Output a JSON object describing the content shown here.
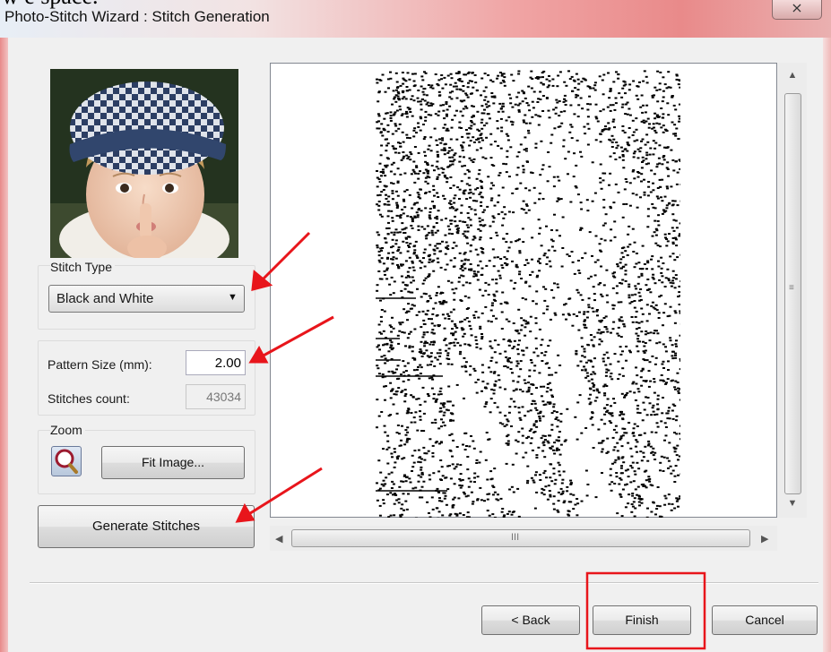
{
  "overlay_text": "w e  space.",
  "window": {
    "title": "Photo-Stitch Wizard : Stitch Generation",
    "close_glyph": "⨯"
  },
  "stitch_type": {
    "group_label": "Stitch Type",
    "selected": "Black and White"
  },
  "pattern": {
    "size_label": "Pattern Size (mm):",
    "size_value": "2.00",
    "count_label": "Stitches count:",
    "count_value": "43034"
  },
  "zoom": {
    "group_label": "Zoom",
    "fit_label": "Fit Image..."
  },
  "generate_label": "Generate Stitches",
  "footer": {
    "back_label": "< Back",
    "finish_label": "Finish",
    "cancel_label": "Cancel"
  },
  "scroll_grip": "III",
  "colors": {
    "annotation_red": "#e8151b",
    "title_gradient_red": "#e98a8a",
    "dialog_bg": "#f0f0f0"
  }
}
